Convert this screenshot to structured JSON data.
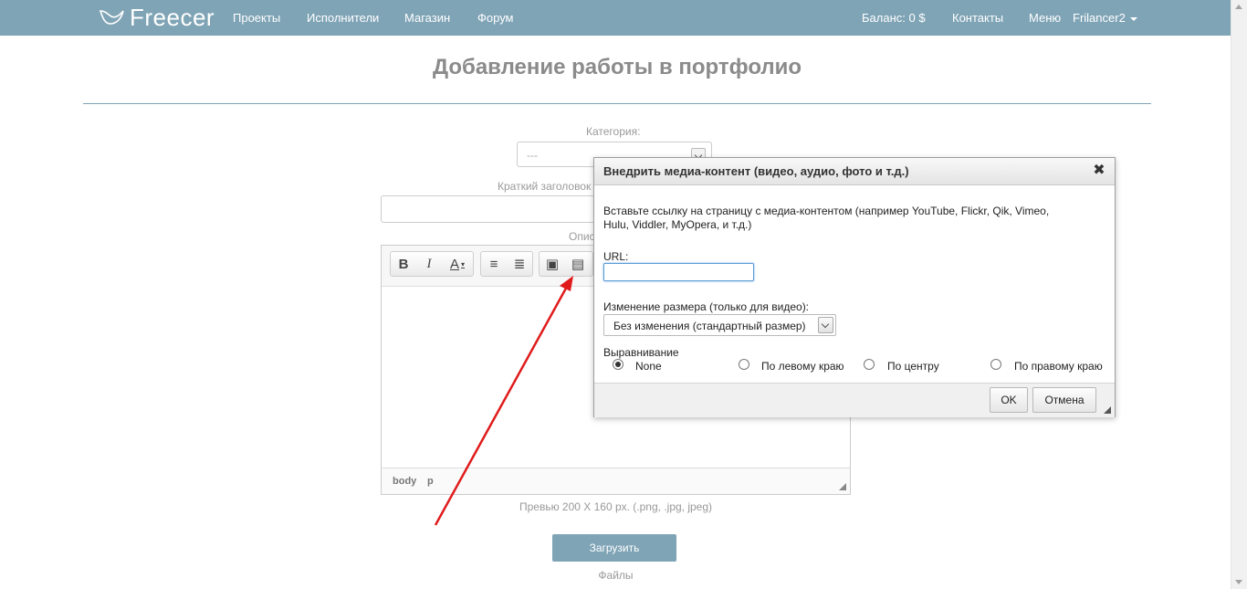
{
  "nav": {
    "logo": "Freecer",
    "items": [
      "Проекты",
      "Исполнители",
      "Магазин",
      "Форум"
    ],
    "balance": "Баланс: 0 $",
    "contacts": "Контакты",
    "menu": "Меню",
    "user": "Frilancer2",
    "bg_color": "#7fa4b6"
  },
  "page": {
    "title": "Добавление работы в портфолио",
    "category_label": "Категория:",
    "category_value": "---",
    "short_title_label": "Краткий заголовок",
    "description_label": "Опис",
    "preview_hint": "Превью 200 X 160 px. (.png, .jpg, jpeg)",
    "upload_button": "Загрузить",
    "files_label": "Файлы"
  },
  "editor": {
    "toolbar": [
      {
        "icon": "bold-icon",
        "glyph": "B"
      },
      {
        "icon": "italic-icon",
        "glyph": "I"
      },
      {
        "icon": "text-color-icon",
        "glyph": "A"
      },
      {
        "icon": "ordered-list-icon",
        "glyph": "≡"
      },
      {
        "icon": "unordered-list-icon",
        "glyph": "≣"
      },
      {
        "icon": "image-icon",
        "glyph": "▣"
      },
      {
        "icon": "media-icon",
        "glyph": "▤"
      }
    ],
    "status_path": [
      "body",
      "p"
    ]
  },
  "dialog": {
    "title": "Внедрить медиа-контент (видео, аудио, фото и т.д.)",
    "close": "✖",
    "instruction_line1": "Вставьте ссылку на страницу с медиа-контентом (например YouTube, Flickr, Qik, Vimeo,",
    "instruction_line2": "Hulu, Viddler, MyOpera, и т.д.)",
    "url_label": "URL:",
    "url_value": "",
    "resize_label": "Изменение размера (только для видео):",
    "resize_value": "Без изменения (стандартный размер)",
    "align_label": "Выравнивание",
    "align_options": [
      "None",
      "По левому краю",
      "По центру",
      "По правому краю"
    ],
    "align_selected": "None",
    "ok": "OK",
    "cancel": "Отмена"
  },
  "colors": {
    "accent": "#7fa4b6",
    "arrow": "#e01b1b"
  }
}
